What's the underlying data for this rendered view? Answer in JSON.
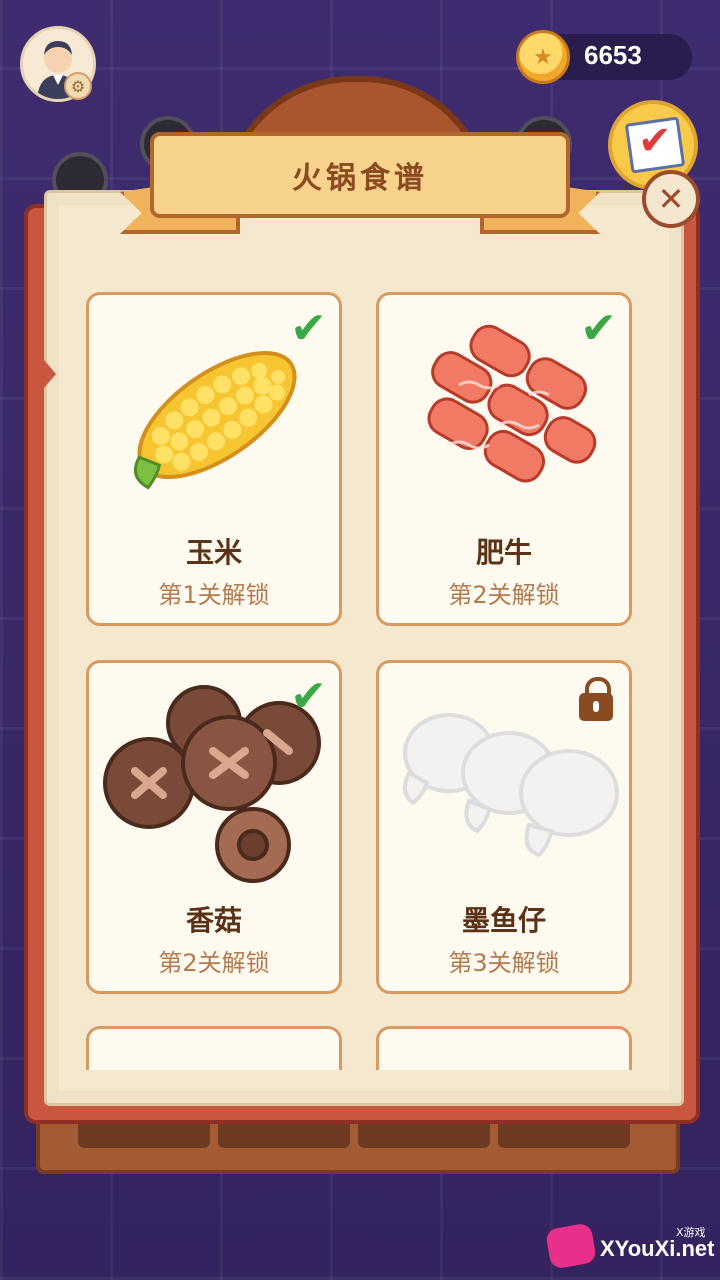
{
  "coins": "6653",
  "title": "火锅食谱",
  "close_symbol": "✕",
  "cards": [
    {
      "name": "玉米",
      "unlock": "第1关解锁",
      "status": "unlocked",
      "icon": "corn-icon"
    },
    {
      "name": "肥牛",
      "unlock": "第2关解锁",
      "status": "unlocked",
      "icon": "beef-icon"
    },
    {
      "name": "香菇",
      "unlock": "第2关解锁",
      "status": "unlocked",
      "icon": "mushroom-icon"
    },
    {
      "name": "墨鱼仔",
      "unlock": "第3关解锁",
      "status": "locked",
      "icon": "squid-icon"
    }
  ],
  "watermark": {
    "brand": "XYouXi.net",
    "tag": "X游戏"
  },
  "colors": {
    "accent": "#d99a62",
    "check": "#3aa844",
    "background": "#3d2a6b"
  }
}
